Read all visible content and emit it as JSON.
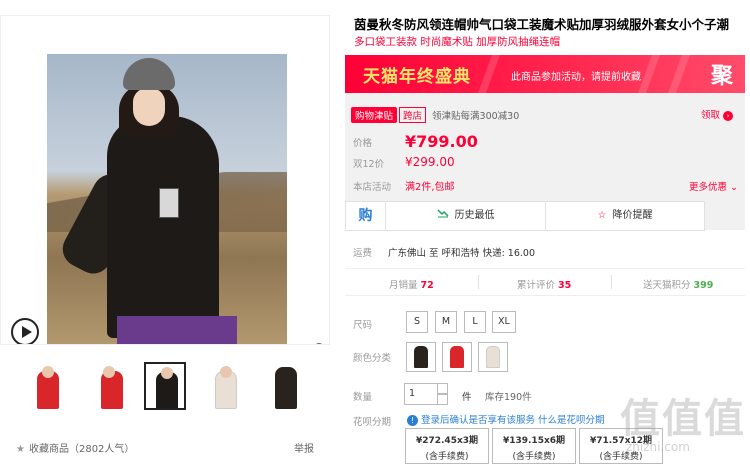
{
  "product": {
    "title": "茵曼秋冬防风领连帽帅气口袋工装魔术贴加厚羽绒服外套女小个子潮",
    "subtitle": "多口袋工装款 时尚魔术贴 加厚防风抽绳连帽"
  },
  "gallery": {
    "favorite_label": "收藏商品（2802人气）",
    "report_label": "举报"
  },
  "banner": {
    "title": "天猫年终盛典",
    "text": "此商品参加活动，请提前收藏",
    "badge": "聚"
  },
  "coupon": {
    "tag": "购物津贴",
    "tag2": "跨店",
    "text": "领津贴每满300减30",
    "claim": "领取"
  },
  "price": {
    "label": "价格",
    "value": "¥799.00",
    "d12_label": "双12价",
    "d12_value": "¥299.00",
    "activity_label": "本店活动",
    "activity_value": "满2件,包邮",
    "more_promo": "更多优惠"
  },
  "tools": {
    "gou_icon": "购",
    "history_low": "历史最低",
    "price_alert": "降价提醒"
  },
  "shipping": {
    "label": "运费",
    "value": "广东佛山 至 呼和浩特 快递: 16.00"
  },
  "stats": {
    "monthly_label": "月销量",
    "monthly_value": "72",
    "reviews_label": "累计评价",
    "reviews_value": "35",
    "points_label": "送天猫积分",
    "points_value": "399"
  },
  "size": {
    "label": "尺码",
    "options": [
      "S",
      "M",
      "L",
      "XL"
    ]
  },
  "color": {
    "label": "颜色分类",
    "swatches": [
      "#2a221c",
      "#d8262a",
      "#eadfd4"
    ]
  },
  "quantity": {
    "label": "数量",
    "value": "1",
    "unit": "件",
    "stock": "库存190件"
  },
  "huabei": {
    "label": "花呗分期",
    "notice": "登录后确认是否享有该服务",
    "link": "什么是花呗分期",
    "options": [
      {
        "amount": "¥272.45x3期",
        "fee": "(含手续费)"
      },
      {
        "amount": "¥139.15x6期",
        "fee": "(含手续费)"
      },
      {
        "amount": "¥71.57x12期",
        "fee": "(含手续费)"
      }
    ]
  },
  "watermark": {
    "text": "值值值",
    "sub": "zhizhi.com"
  },
  "colors": {
    "accent": "#ff0036",
    "link": "#2a7fd4",
    "green": "#4caf50"
  }
}
